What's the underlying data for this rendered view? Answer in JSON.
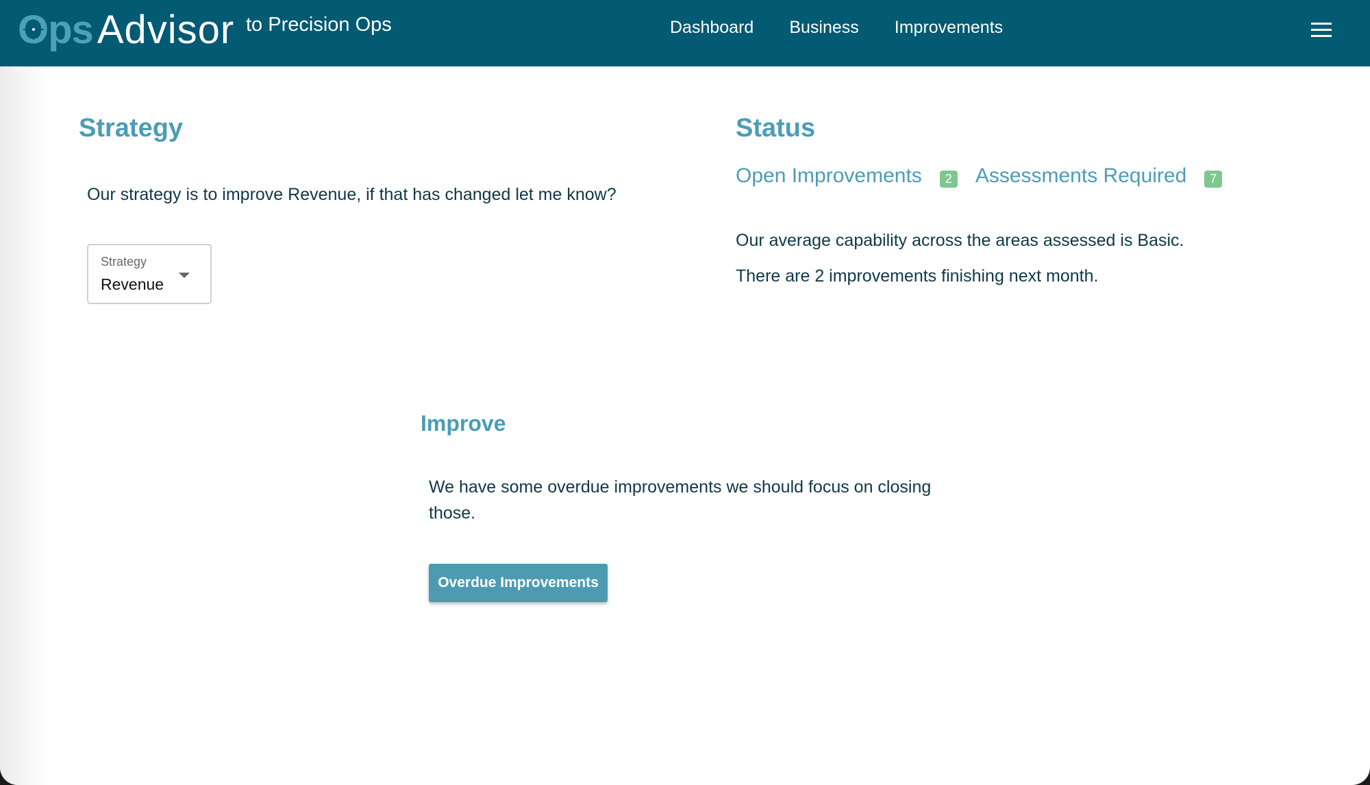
{
  "header": {
    "logo_ops": "Ops",
    "logo_advisor": "Advisor",
    "tagline": "to Precision Ops",
    "nav": [
      {
        "label": "Dashboard"
      },
      {
        "label": "Business"
      },
      {
        "label": "Improvements"
      }
    ],
    "menu_icon": "hamburger-menu-icon"
  },
  "strategy": {
    "title": "Strategy",
    "text": "Our strategy is to improve Revenue, if that has changed let me know?",
    "select": {
      "label": "Strategy",
      "value": "Revenue"
    }
  },
  "status": {
    "title": "Status",
    "links": [
      {
        "label": "Open Improvements",
        "count": "2"
      },
      {
        "label": "Assessments Required",
        "count": "7"
      }
    ],
    "lines": [
      "Our average capability across the areas assessed is Basic.",
      "There are 2 improvements finishing next month."
    ]
  },
  "improve": {
    "title": "Improve",
    "text": "We have some overdue improvements we should focus on closing those.",
    "button_label": "Overdue Improvements"
  },
  "colors": {
    "header_bg": "#035a73",
    "accent": "#4a9db5",
    "badge": "#7ec890",
    "text": "#0f3848"
  }
}
